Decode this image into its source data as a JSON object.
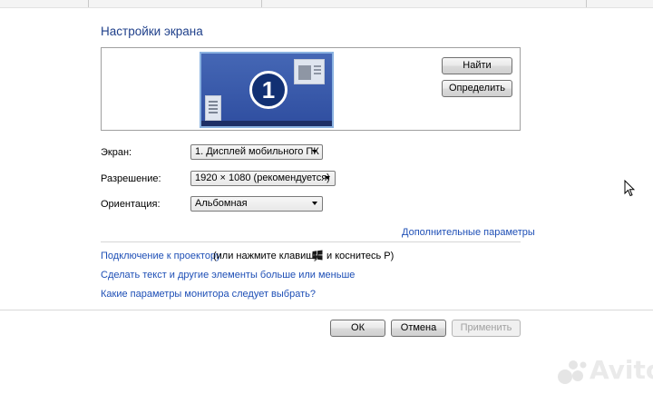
{
  "title": "Настройки экрана",
  "preview": {
    "monitor_number": "1",
    "find_button": "Найти",
    "identify_button": "Определить"
  },
  "settings": {
    "display_label": "Экран:",
    "display_value": "1. Дисплей мобильного ПК",
    "resolution_label": "Разрешение:",
    "resolution_value": "1920 × 1080 (рекомендуется)",
    "orientation_label": "Ориентация:",
    "orientation_value": "Альбомная"
  },
  "advanced_link": "Дополнительные параметры",
  "links": {
    "projector_link": "Подключение к проектору",
    "projector_hint_pre": "(или нажмите клавишу",
    "projector_hint_post": "и коснитесь P)",
    "text_size_link": "Сделать текст и другие элементы больше или меньше",
    "monitor_help_link": "Какие параметры монитора следует выбрать?"
  },
  "footer": {
    "ok": "ОК",
    "cancel": "Отмена",
    "apply": "Применить"
  },
  "watermark": "Avito",
  "icons": {
    "windows_key": "windows-logo-icon",
    "cursor": "mouse-pointer-icon",
    "dropdown": "chevron-down-icon"
  }
}
